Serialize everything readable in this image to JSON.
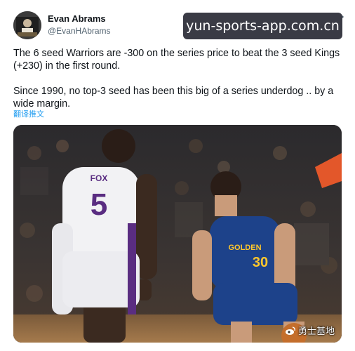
{
  "author": {
    "name": "Evan Abrams",
    "handle": "@EvanHAbrams"
  },
  "watermark": {
    "text": "yun-sports-app.com.cn"
  },
  "tweet": {
    "paragraphs": [
      "The 6 seed Warriors are -300 on the series price to beat the 3 seed Kings (+230) in the first round.",
      "Since 1990, no top-3 seed has been this big of a series underdog .. by a wide margin."
    ],
    "translate_label": "翻译推文"
  },
  "photo": {
    "jersey_left_name": "FOX",
    "jersey_left_number": "5",
    "jersey_right_team": "GOLDEN",
    "jersey_right_number": "30",
    "colors": {
      "kings_purple": "#5a2d81",
      "warriors_blue": "#1d428a",
      "warriors_gold": "#ffc72c"
    }
  },
  "corner_watermark": {
    "text": "勇士基地"
  },
  "icons": {
    "more": "more-dots-icon",
    "weibo": "weibo-icon"
  }
}
